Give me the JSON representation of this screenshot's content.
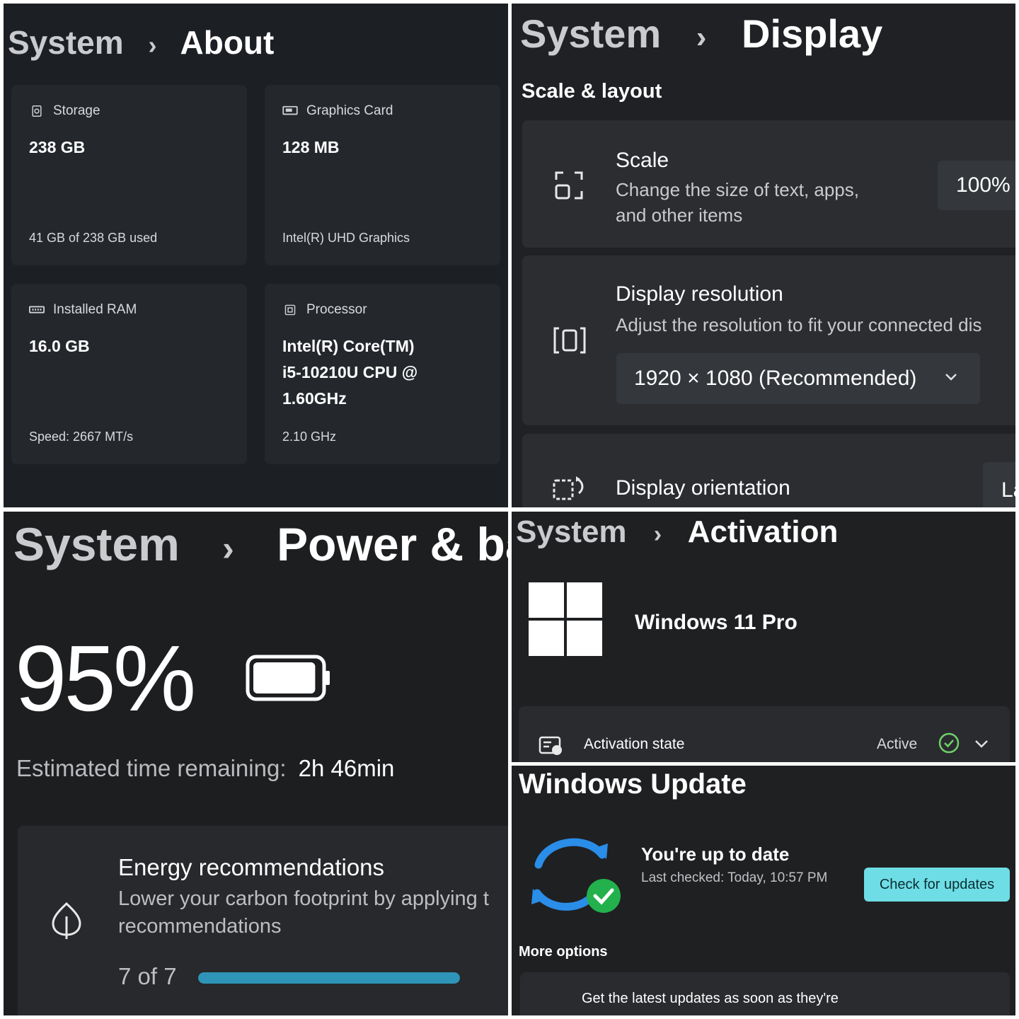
{
  "about": {
    "crumb_root": "System",
    "crumb_sep": "›",
    "crumb_page": "About",
    "cards": [
      {
        "label": "Storage",
        "icon": "storage-icon",
        "value": "238 GB",
        "sub": "41 GB of 238 GB used"
      },
      {
        "label": "Graphics Card",
        "icon": "graphics-card-icon",
        "value": "128 MB",
        "sub": "Intel(R) UHD Graphics"
      },
      {
        "label": "Installed RAM",
        "icon": "ram-icon",
        "value": "16.0 GB",
        "sub": "Speed: 2667 MT/s"
      },
      {
        "label": "Processor",
        "icon": "processor-icon",
        "value_lines": [
          "Intel(R) Core(TM)",
          "i5-10210U CPU @",
          "1.60GHz"
        ],
        "sub": "2.10 GHz"
      }
    ]
  },
  "display": {
    "crumb_root": "System",
    "crumb_sep": "›",
    "crumb_page": "Display",
    "section": "Scale & layout",
    "scale": {
      "title": "Scale",
      "desc_line1": "Change the size of text, apps,",
      "desc_line2": "and other items",
      "value": "100%"
    },
    "resolution": {
      "title": "Display resolution",
      "desc": "Adjust the resolution to fit your connected dis",
      "value": "1920 × 1080 (Recommended)"
    },
    "orientation": {
      "title": "Display orientation",
      "value": "La"
    }
  },
  "power": {
    "crumb_root": "System",
    "crumb_sep": "›",
    "crumb_page": "Power & bat",
    "battery_percent": "95%",
    "battery_level": 0.95,
    "estimate_label": "Estimated time remaining:",
    "estimate_value": "2h 46min",
    "energy_title": "Energy recommendations",
    "energy_desc_line1": "Lower your carbon footprint by applying t",
    "energy_desc_line2": "recommendations",
    "progress_text": "7 of 7",
    "progress_fraction": 1.0,
    "progress_color": "#2f95b8"
  },
  "activation": {
    "crumb_root": "System",
    "crumb_sep": "›",
    "crumb_page": "Activation",
    "edition": "Windows 11 Pro",
    "state_label": "Activation state",
    "state_value": "Active",
    "status_color": "#6fcf6a"
  },
  "update": {
    "title": "Windows Update",
    "status": "You're up to date",
    "last_checked": "Last checked: Today, 10:57 PM",
    "check_button": "Check for updates",
    "more_options": "More options",
    "get_latest": "Get the latest updates as soon as they're",
    "accent": "#6fdde5"
  }
}
